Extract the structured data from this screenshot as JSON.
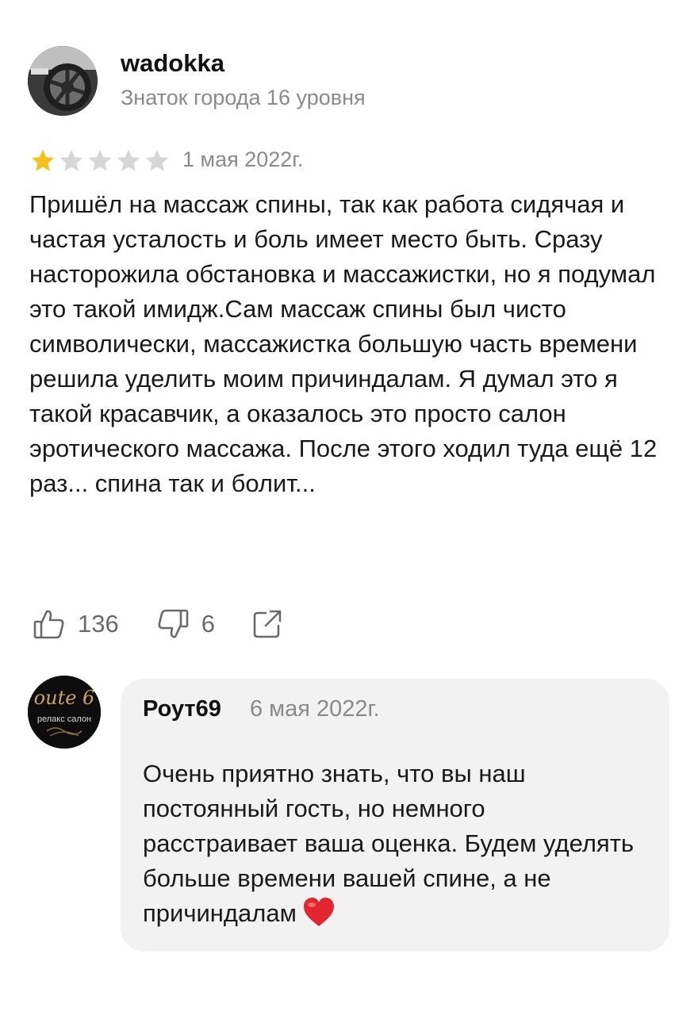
{
  "review": {
    "author": {
      "name": "wadokka",
      "level": "Знаток города 16 уровня"
    },
    "rating": 1,
    "max_rating": 5,
    "date": "1 мая 2022г.",
    "text": "Пришёл на массаж спины, так как работа сидячая и частая усталость и боль имеет место быть. Сразу насторожила обстановка и массажистки, но я подумал это такой имидж.Сам массаж спины был чисто символически, массажистка большую часть времени решила уделить моим причиндалам. Я думал это я такой красавчик, а оказалось это просто салон эротического массажа. После этого ходил туда ещё 12 раз... спина так и болит...",
    "likes": "136",
    "dislikes": "6"
  },
  "reply": {
    "author": "Роут69",
    "date": "6 мая 2022г.",
    "text": "Очень приятно знать, что вы наш постоянный гость, но немного расстраивает ваша оценка. Будем уделять больше времени вашей спине, а не причиндалам",
    "avatar_logo_text": "oute 6",
    "avatar_caption": "релакс салон"
  },
  "colors": {
    "star_filled": "#f6c21a",
    "star_empty": "#d6d6d6",
    "muted_text": "#8a8a8a",
    "reply_bg": "#f2f2f3",
    "heart": "#e3252d"
  },
  "icons": {
    "like": "thumbs-up-icon",
    "dislike": "thumbs-down-icon",
    "share": "share-icon",
    "heart": "heart-icon"
  }
}
